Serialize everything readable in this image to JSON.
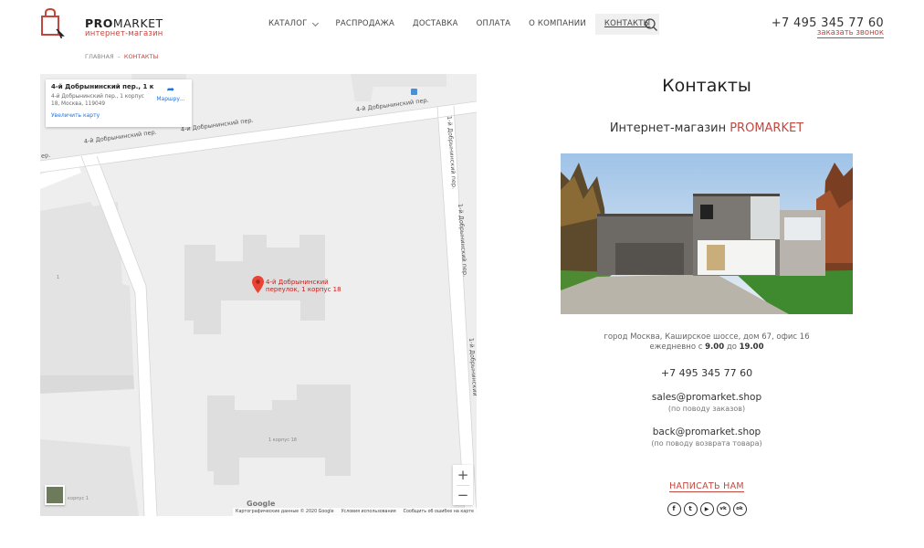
{
  "header": {
    "brand_bold": "PRO",
    "brand_rest": "MARKET",
    "brand_sub": "интернет-магазин",
    "phone": "+7 495 345 77 60",
    "callback": "заказать звонок",
    "nav": [
      {
        "label": "Каталог",
        "has_dropdown": true
      },
      {
        "label": "Распродажа"
      },
      {
        "label": "Доставка"
      },
      {
        "label": "Оплата"
      },
      {
        "label": "О компании"
      },
      {
        "label": "Контакты",
        "active": true
      }
    ]
  },
  "breadcrumb": {
    "home": "Главная",
    "sep": "–",
    "current": "Контакты"
  },
  "map": {
    "card_title": "4-й Добрынинский пер., 1 ко...",
    "card_address": "4-й Добрынинский пер., 1 корпус 18, Москва, 119049",
    "card_link": "Увеличить карту",
    "route_label": "Маршру...",
    "pin_label": "4-й Добрынинский переулок, 1 корпус 18",
    "street_1": "4-й Добрынинский пер.",
    "street_2": "4-й Добрынинский пер.",
    "street_3": "4-й Добрынинский пер.",
    "street_4": "1-й Добрынинский пер.",
    "street_5": "1-й Добрынинский пер.",
    "street_6": "1-й Добрынинский",
    "building_1": "1 корпус 18",
    "building_2": "корпус 1",
    "building_3": "1",
    "street_7": "ер.",
    "google": "Google",
    "footer_data": "Картографические данные © 2020 Google",
    "footer_terms": "Условия использования",
    "footer_report": "Сообщить об ошибке на карте",
    "zoom_in": "+",
    "zoom_out": "−"
  },
  "contacts": {
    "title": "Контакты",
    "shop_prefix": "Интернет-магазин",
    "shop_name": "PROMARKET",
    "address": "город Москва, Каширское шоссе, дом 67, офис 16",
    "hours_prefix": "ежедневно с",
    "hours_from": "9.00",
    "hours_mid": "до",
    "hours_to": "19.00",
    "phone": "+7 495 345 77 60",
    "email_sales": "sales@promarket.shop",
    "email_sales_note": "(по поводу заказов)",
    "email_back": "back@promarket.shop",
    "email_back_note": "(по поводу возврата товара)",
    "write_button": "Написать нам",
    "socials": [
      {
        "icon": "facebook-icon",
        "glyph": "f"
      },
      {
        "icon": "twitter-icon",
        "glyph": "t"
      },
      {
        "icon": "youtube-icon",
        "glyph": "▶"
      },
      {
        "icon": "vk-icon",
        "glyph": "vk"
      },
      {
        "icon": "odnoklassniki-icon",
        "glyph": "ok"
      }
    ]
  },
  "colors": {
    "accent": "#c2473e",
    "text": "#333333"
  }
}
